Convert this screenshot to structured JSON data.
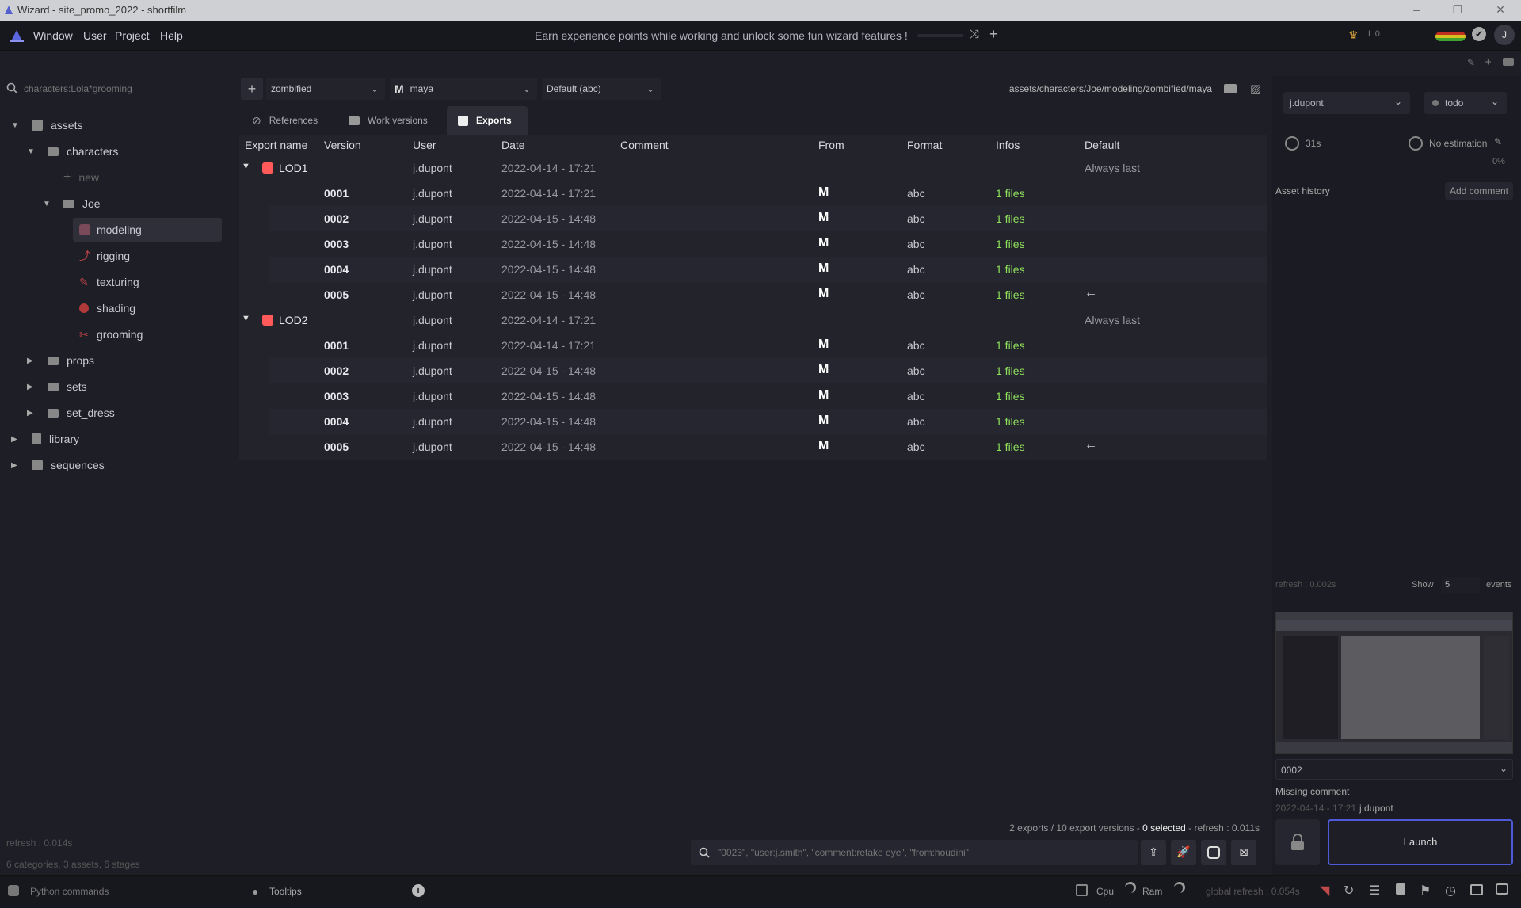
{
  "window": {
    "title": "Wizard - site_promo_2022 - shortfilm",
    "controls": [
      "–",
      "❐",
      "✕"
    ]
  },
  "menu": {
    "items": [
      "Window",
      "User",
      "Project",
      "Help"
    ],
    "hint": "Earn experience points while working and unlock some fun wizard features !",
    "level": "L 0",
    "avatar": "J"
  },
  "search": {
    "placeholder": "characters:Lola*grooming"
  },
  "tree": {
    "assets": "assets",
    "characters": "characters",
    "new": "new",
    "joe": "Joe",
    "modeling": "modeling",
    "rigging": "rigging",
    "texturing": "texturing",
    "shading": "shading",
    "grooming": "grooming",
    "props": "props",
    "sets": "sets",
    "set_dress": "set_dress",
    "library": "library",
    "sequences": "sequences"
  },
  "left_footer": {
    "refresh": "refresh : 0.014s",
    "summary": "6 categories, 3 assets, 6 stages"
  },
  "toolbar": {
    "variant": "zombified",
    "software": "maya",
    "export_format": "Default (abc)",
    "path": "assets/characters/Joe/modeling/zombified/maya"
  },
  "tabs": {
    "references": "References",
    "work_versions": "Work versions",
    "exports": "Exports"
  },
  "columns": {
    "export_name": "Export name",
    "version": "Version",
    "user": "User",
    "date": "Date",
    "comment": "Comment",
    "from": "From",
    "format": "Format",
    "infos": "Infos",
    "default": "Default"
  },
  "exports": [
    {
      "name": "LOD1",
      "user": "j.dupont",
      "date": "2022-04-14 - 17:21",
      "default": "Always last",
      "versions": [
        {
          "version": "0001",
          "user": "j.dupont",
          "date": "2022-04-14 - 17:21",
          "from": "M",
          "format": "abc",
          "infos": "1 files",
          "default": ""
        },
        {
          "version": "0002",
          "user": "j.dupont",
          "date": "2022-04-15 - 14:48",
          "from": "M",
          "format": "abc",
          "infos": "1 files",
          "default": ""
        },
        {
          "version": "0003",
          "user": "j.dupont",
          "date": "2022-04-15 - 14:48",
          "from": "M",
          "format": "abc",
          "infos": "1 files",
          "default": ""
        },
        {
          "version": "0004",
          "user": "j.dupont",
          "date": "2022-04-15 - 14:48",
          "from": "M",
          "format": "abc",
          "infos": "1 files",
          "default": ""
        },
        {
          "version": "0005",
          "user": "j.dupont",
          "date": "2022-04-15 - 14:48",
          "from": "M",
          "format": "abc",
          "infos": "1 files",
          "default": "←"
        }
      ]
    },
    {
      "name": "LOD2",
      "user": "j.dupont",
      "date": "2022-04-14 - 17:21",
      "default": "Always last",
      "versions": [
        {
          "version": "0001",
          "user": "j.dupont",
          "date": "2022-04-14 - 17:21",
          "from": "M",
          "format": "abc",
          "infos": "1 files",
          "default": ""
        },
        {
          "version": "0002",
          "user": "j.dupont",
          "date": "2022-04-15 - 14:48",
          "from": "M",
          "format": "abc",
          "infos": "1 files",
          "default": ""
        },
        {
          "version": "0003",
          "user": "j.dupont",
          "date": "2022-04-15 - 14:48",
          "from": "M",
          "format": "abc",
          "infos": "1 files",
          "default": ""
        },
        {
          "version": "0004",
          "user": "j.dupont",
          "date": "2022-04-15 - 14:48",
          "from": "M",
          "format": "abc",
          "infos": "1 files",
          "default": ""
        },
        {
          "version": "0005",
          "user": "j.dupont",
          "date": "2022-04-15 - 14:48",
          "from": "M",
          "format": "abc",
          "infos": "1 files",
          "default": "←"
        }
      ]
    }
  ],
  "center_footer": {
    "counts": "2 exports / 10 export versions - ",
    "selected": "0 selected",
    "refresh": " - refresh : 0.011s",
    "search_placeholder": "\"0023\", \"user:j.smith\", \"comment:retake eye\", \"from:houdini\""
  },
  "right": {
    "user": "j.dupont",
    "state": "todo",
    "time": "31s",
    "estimation": "No estimation",
    "percent": "0%",
    "history_label": "Asset history",
    "add_comment": "Add comment",
    "refresh": "refresh : 0.002s",
    "show": "Show",
    "show_count": "5",
    "events": "events",
    "version": "0002",
    "missing_comment": "Missing comment",
    "version_date": "2022-04-14 - 17:21",
    "version_user": "j.dupont",
    "launch": "Launch"
  },
  "status": {
    "python": "Python commands",
    "tooltips": "Tooltips",
    "cpu": "Cpu",
    "ram": "Ram",
    "global_refresh": "global refresh : 0.054s"
  },
  "colors": {
    "accent": "#4f5ad8",
    "files": "#8fe05a",
    "export_icon": "#ff5a5a"
  }
}
